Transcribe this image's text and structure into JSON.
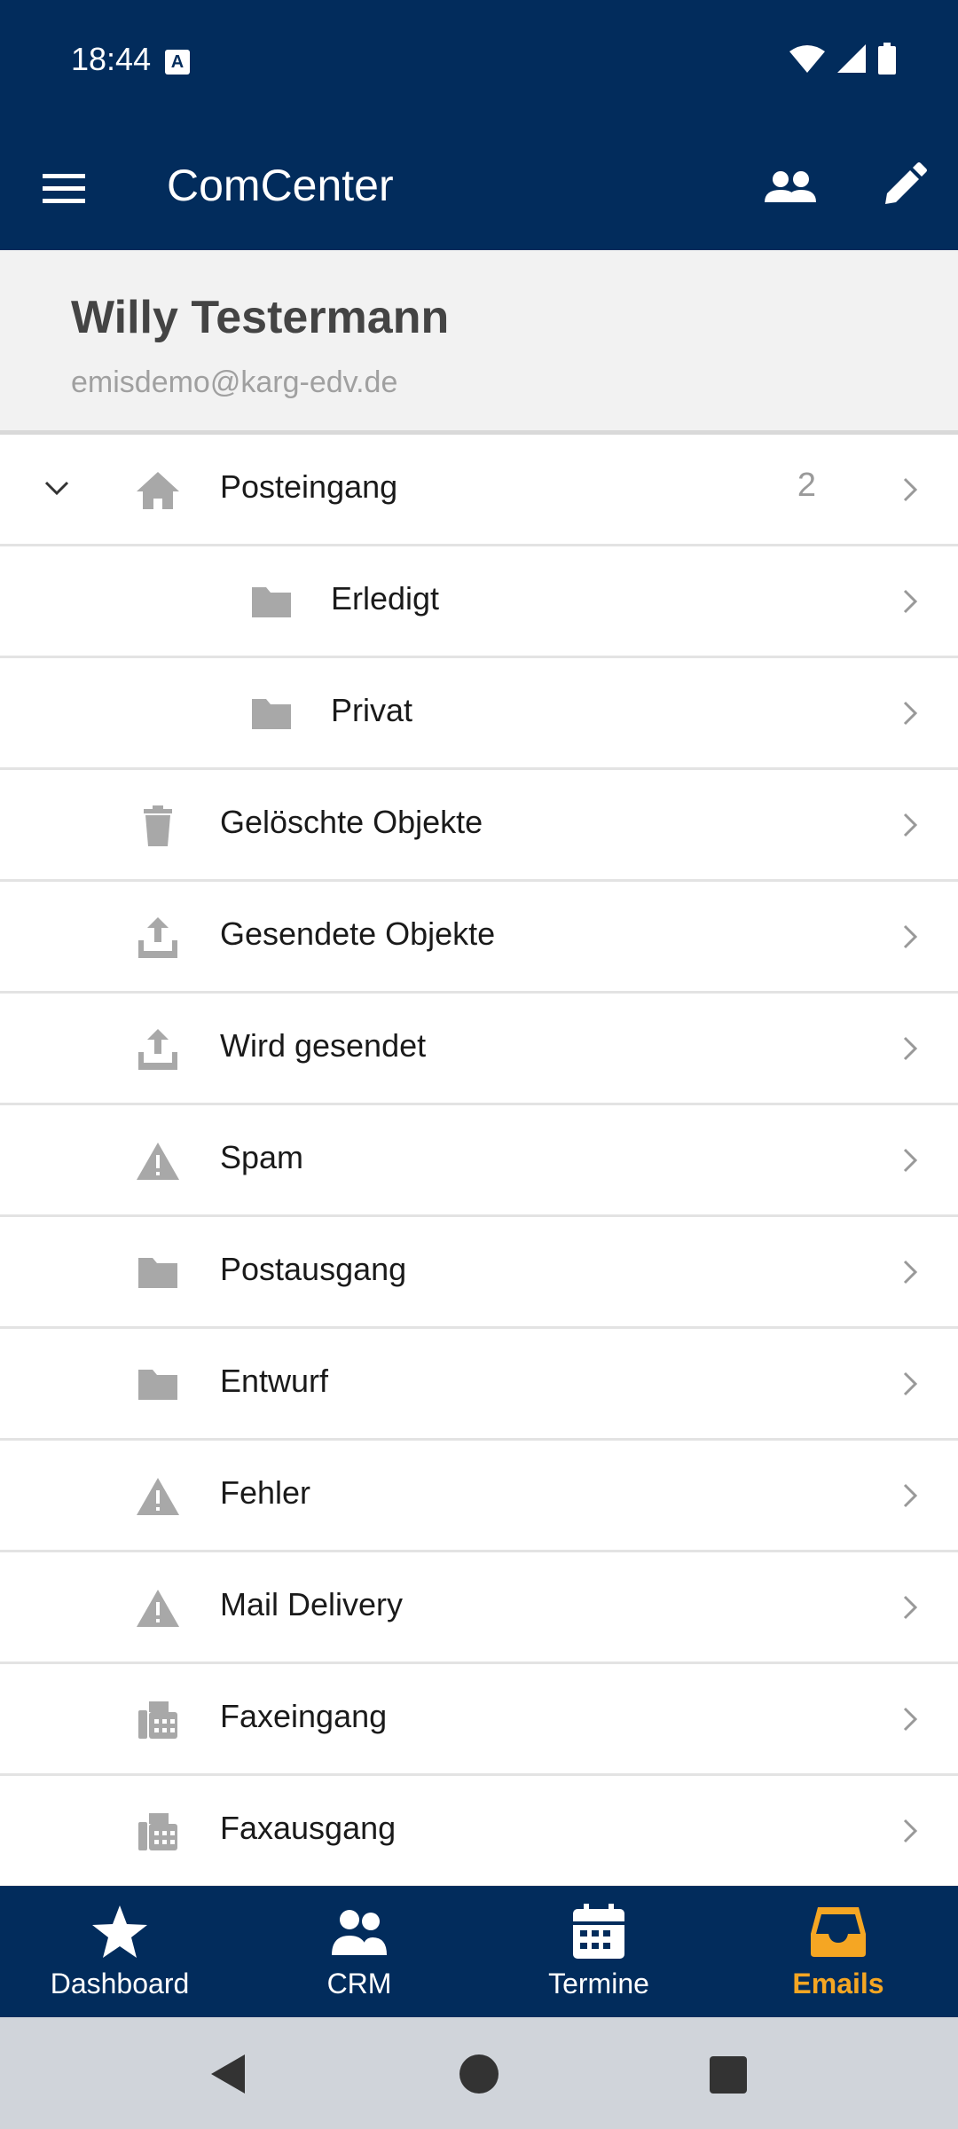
{
  "status_bar": {
    "time": "18:44",
    "notification_icon": "A"
  },
  "app_bar": {
    "title": "ComCenter",
    "menu_icon": "hamburger-icon",
    "people_icon": "people-icon",
    "edit_icon": "pencil-icon"
  },
  "profile": {
    "name": "Willy Testermann",
    "email": "emisdemo@karg-edv.de"
  },
  "folders": [
    {
      "label": "Posteingang",
      "icon": "home-icon",
      "count": "2",
      "expanded": true,
      "level": 0
    },
    {
      "label": "Erledigt",
      "icon": "folder-icon",
      "level": 1
    },
    {
      "label": "Privat",
      "icon": "folder-icon",
      "level": 1
    },
    {
      "label": "Gelöschte Objekte",
      "icon": "trash-icon",
      "level": 0
    },
    {
      "label": "Gesendete Objekte",
      "icon": "upload-icon",
      "level": 0
    },
    {
      "label": "Wird gesendet",
      "icon": "upload-icon",
      "level": 0
    },
    {
      "label": "Spam",
      "icon": "warning-icon",
      "level": 0
    },
    {
      "label": "Postausgang",
      "icon": "folder-icon",
      "level": 0
    },
    {
      "label": "Entwurf",
      "icon": "folder-icon",
      "level": 0
    },
    {
      "label": "Fehler",
      "icon": "warning-icon",
      "level": 0
    },
    {
      "label": "Mail Delivery",
      "icon": "warning-icon",
      "level": 0
    },
    {
      "label": "Faxeingang",
      "icon": "fax-icon",
      "level": 0
    },
    {
      "label": "Faxausgang",
      "icon": "fax-icon",
      "level": 0
    }
  ],
  "bottom_nav": [
    {
      "label": "Dashboard",
      "icon": "star-icon"
    },
    {
      "label": "CRM",
      "icon": "people-icon"
    },
    {
      "label": "Termine",
      "icon": "calendar-icon"
    },
    {
      "label": "Emails",
      "icon": "inbox-icon",
      "active": true
    }
  ],
  "colors": {
    "primary": "#022c5c",
    "accent": "#f5a623",
    "icon_gray": "#a8a8a8"
  }
}
